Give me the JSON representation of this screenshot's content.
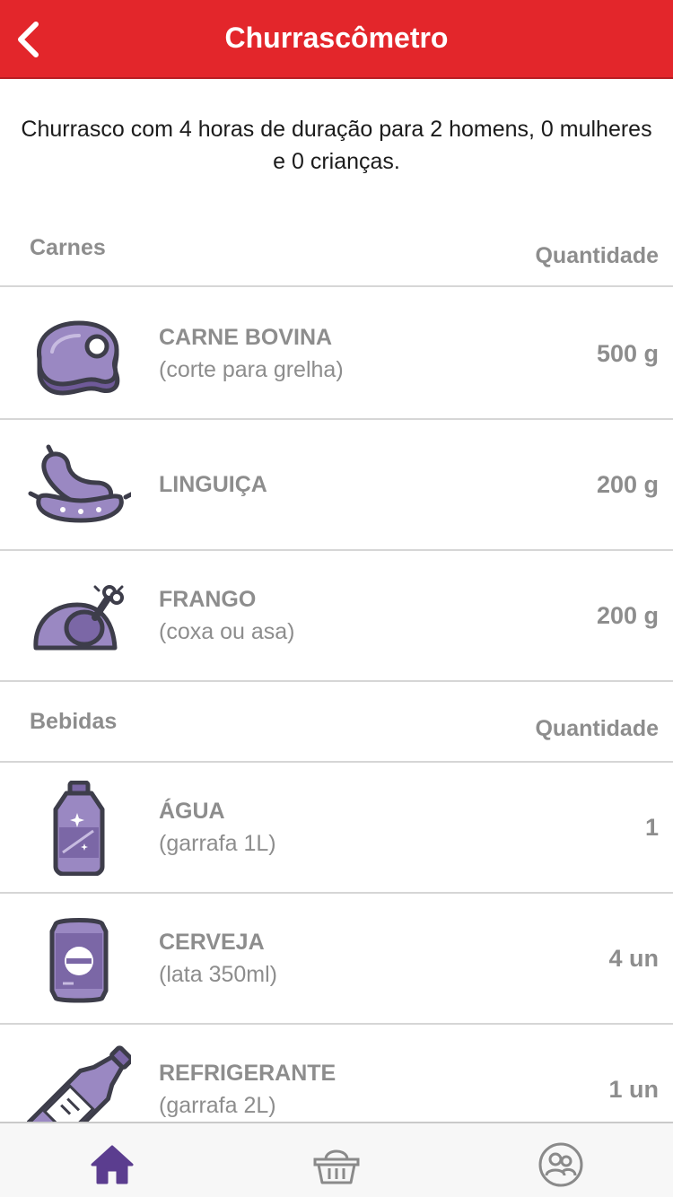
{
  "header": {
    "title": "Churrascômetro",
    "back_icon": "chevron-left-icon"
  },
  "summary": "Churrasco com 4 horas de duração para 2 homens, 0 mulheres e 0 crianças.",
  "sections": [
    {
      "name": "Carnes",
      "qty_label": "Quantidade",
      "items": [
        {
          "name": "CARNE BOVINA",
          "sub": "(corte para grelha)",
          "qty": "500 g",
          "icon": "steak-icon"
        },
        {
          "name": "LINGUIÇA",
          "sub": "",
          "qty": "200 g",
          "icon": "sausage-icon"
        },
        {
          "name": "FRANGO",
          "sub": "(coxa ou asa)",
          "qty": "200 g",
          "icon": "chicken-icon"
        }
      ]
    },
    {
      "name": "Bebidas",
      "qty_label": "Quantidade",
      "items": [
        {
          "name": "ÁGUA",
          "sub": "(garrafa 1L)",
          "qty": "1",
          "icon": "water-bottle-icon"
        },
        {
          "name": "CERVEJA",
          "sub": "(lata 350ml)",
          "qty": "4 un",
          "icon": "beer-can-icon"
        },
        {
          "name": "REFRIGERANTE",
          "sub": "(garrafa 2L)",
          "qty": "1 un",
          "icon": "soda-bottle-icon"
        }
      ]
    }
  ],
  "tabbar": [
    {
      "name": "home",
      "icon": "home-icon",
      "active": true
    },
    {
      "name": "basket",
      "icon": "basket-icon",
      "active": false
    },
    {
      "name": "people",
      "icon": "people-icon",
      "active": false
    }
  ],
  "colors": {
    "header": "#e3262b",
    "icon_fill": "#8e7bb5",
    "icon_stroke": "#3d3d4a",
    "text_muted": "#8d8d8d",
    "tab_active": "#5b3d8f",
    "tab_inactive": "#8a8a8a"
  }
}
